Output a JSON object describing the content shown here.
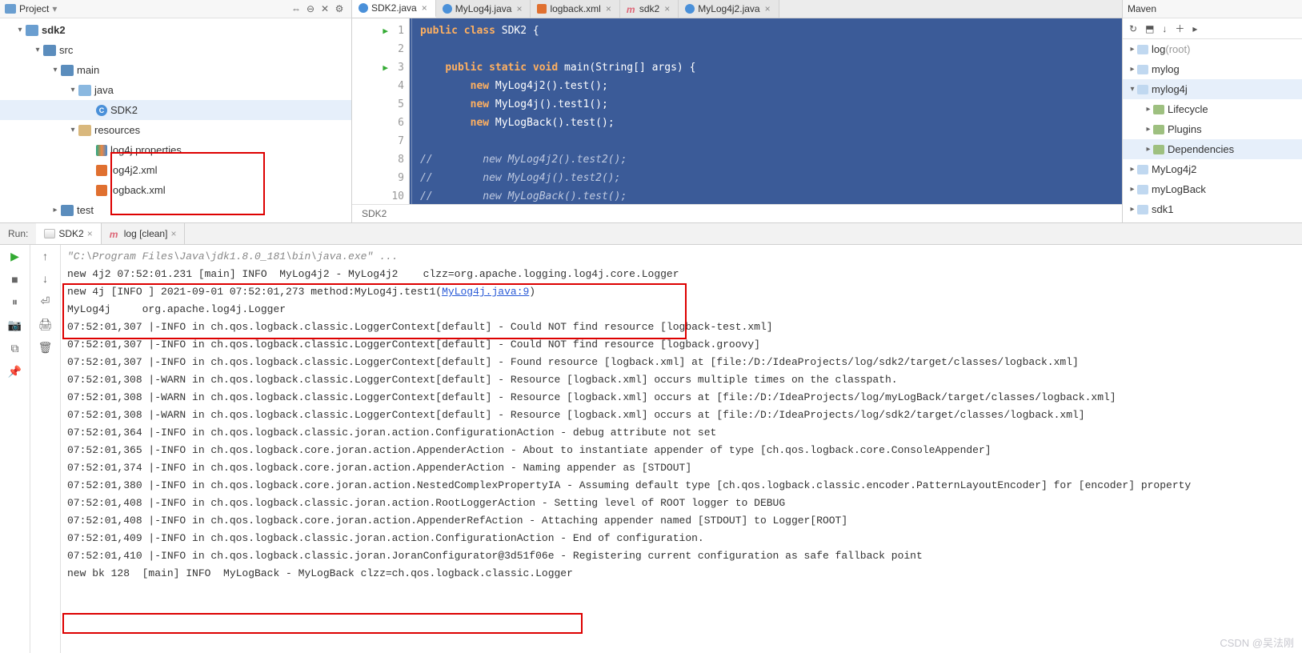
{
  "project": {
    "header_title": "Project",
    "toolbar_icons": [
      "⇔",
      "⊖",
      "✕",
      "⚙"
    ],
    "tree": [
      {
        "depth": 0,
        "twisty": "▾",
        "icon": "folder",
        "label": "sdk2",
        "bold": true
      },
      {
        "depth": 1,
        "twisty": "▾",
        "icon": "folder src",
        "label": "src"
      },
      {
        "depth": 2,
        "twisty": "▾",
        "icon": "folder src",
        "label": "main"
      },
      {
        "depth": 3,
        "twisty": "▾",
        "icon": "folder java",
        "label": "java"
      },
      {
        "depth": 4,
        "twisty": "",
        "icon": "cls",
        "icon_text": "C",
        "label": "SDK2",
        "selected": true
      },
      {
        "depth": 3,
        "twisty": "▾",
        "icon": "folder res",
        "label": "resources"
      },
      {
        "depth": 4,
        "twisty": "",
        "icon": "prop",
        "label": "log4j.properties"
      },
      {
        "depth": 4,
        "twisty": "",
        "icon": "xml",
        "label": "log4j2.xml"
      },
      {
        "depth": 4,
        "twisty": "",
        "icon": "xml",
        "label": "logback.xml"
      },
      {
        "depth": 2,
        "twisty": "▸",
        "icon": "folder src",
        "label": "test"
      }
    ]
  },
  "tabs": [
    {
      "icon": "c",
      "label": "SDK2.java",
      "active": true
    },
    {
      "icon": "c",
      "label": "MyLog4j.java"
    },
    {
      "icon": "x",
      "label": "logback.xml"
    },
    {
      "icon": "m",
      "label": "sdk2"
    },
    {
      "icon": "c",
      "label": "MyLog4j2.java"
    }
  ],
  "editor": {
    "lines": [
      {
        "n": 1,
        "run": true,
        "html": "<span class='kw'>public class</span> SDK2 {"
      },
      {
        "n": 2,
        "html": ""
      },
      {
        "n": 3,
        "run": true,
        "html": "    <span class='kw'>public static void</span> main(String[] args) {"
      },
      {
        "n": 4,
        "html": "        <span class='kw'>new</span> MyLog4j2().test();"
      },
      {
        "n": 5,
        "html": "        <span class='kw'>new</span> MyLog4j().test1();"
      },
      {
        "n": 6,
        "html": "        <span class='kw'>new</span> MyLogBack().test();"
      },
      {
        "n": 7,
        "html": ""
      },
      {
        "n": 8,
        "html": "<span class='cm'>//        new MyLog4j2().test2();</span>"
      },
      {
        "n": 9,
        "html": "<span class='cm'>//        new MyLog4j().test2();</span>"
      },
      {
        "n": 10,
        "html": "<span class='cm'>//        new MyLogBack().test();</span>"
      }
    ],
    "breadcrumb": "SDK2"
  },
  "maven": {
    "title": "Maven",
    "toolbar": [
      "↻",
      "⬒",
      "↓",
      "＋",
      "▸"
    ],
    "tree": [
      {
        "depth": 0,
        "tw": "▸",
        "icon": "mod",
        "label": "log",
        "dim": " (root)"
      },
      {
        "depth": 0,
        "tw": "▸",
        "icon": "mod",
        "label": "mylog"
      },
      {
        "depth": 0,
        "tw": "▾",
        "icon": "mod",
        "label": "mylog4j",
        "sel": true
      },
      {
        "depth": 1,
        "tw": "▸",
        "icon": "pl",
        "label": "Lifecycle"
      },
      {
        "depth": 1,
        "tw": "▸",
        "icon": "pl",
        "label": "Plugins"
      },
      {
        "depth": 1,
        "tw": "▸",
        "icon": "pl",
        "label": "Dependencies",
        "sel": true
      },
      {
        "depth": 0,
        "tw": "▸",
        "icon": "mod",
        "label": "MyLog4j2"
      },
      {
        "depth": 0,
        "tw": "▸",
        "icon": "mod",
        "label": "myLogBack"
      },
      {
        "depth": 0,
        "tw": "▸",
        "icon": "mod",
        "label": "sdk1"
      }
    ]
  },
  "run": {
    "label": "Run:",
    "tabs": [
      {
        "icon": "java",
        "label": "SDK2",
        "active": true
      },
      {
        "icon": "mvn",
        "label": "log [clean]"
      }
    ],
    "gutter1": [
      {
        "glyph": "▶",
        "cls": "play",
        "name": "run-button"
      },
      {
        "glyph": "■",
        "name": "stop-button"
      },
      {
        "glyph": "⏸",
        "name": "pause-button"
      },
      {
        "glyph": "📷",
        "name": "dump-threads-button"
      },
      {
        "glyph": "⧉",
        "name": "layout-button"
      },
      {
        "glyph": "📌",
        "name": "pin-button"
      }
    ],
    "gutter2": [
      {
        "glyph": "↑",
        "name": "up-button"
      },
      {
        "glyph": "↓",
        "name": "down-button"
      },
      {
        "glyph": "⏎",
        "name": "softwrap-button"
      },
      {
        "glyph": "🖨",
        "name": "print-button"
      },
      {
        "glyph": "🗑",
        "name": "clear-button"
      }
    ],
    "console": [
      {
        "t": "\"C:\\Program Files\\Java\\jdk1.8.0_181\\bin\\java.exe\" ...",
        "cls": "dim"
      },
      {
        "t": "new 4j2 07:52:01.231 [main] INFO  MyLog4j2 - MyLog4j2    clzz=org.apache.logging.log4j.core.Logger"
      },
      {
        "t": "new 4j [INFO ] 2021-09-01 07:52:01,273 method:MyLog4j.test1(",
        "link": "MyLog4j.java:9",
        "tail": ")"
      },
      {
        "t": "MyLog4j     org.apache.log4j.Logger"
      },
      {
        "t": "07:52:01,307 |-INFO in ch.qos.logback.classic.LoggerContext[default] - Could NOT find resource [logback-test.xml]"
      },
      {
        "t": "07:52:01,307 |-INFO in ch.qos.logback.classic.LoggerContext[default] - Could NOT find resource [logback.groovy]"
      },
      {
        "t": "07:52:01,307 |-INFO in ch.qos.logback.classic.LoggerContext[default] - Found resource [logback.xml] at [file:/D:/IdeaProjects/log/sdk2/target/classes/logback.xml]"
      },
      {
        "t": "07:52:01,308 |-WARN in ch.qos.logback.classic.LoggerContext[default] - Resource [logback.xml] occurs multiple times on the classpath."
      },
      {
        "t": "07:52:01,308 |-WARN in ch.qos.logback.classic.LoggerContext[default] - Resource [logback.xml] occurs at [file:/D:/IdeaProjects/log/myLogBack/target/classes/logback.xml]"
      },
      {
        "t": "07:52:01,308 |-WARN in ch.qos.logback.classic.LoggerContext[default] - Resource [logback.xml] occurs at [file:/D:/IdeaProjects/log/sdk2/target/classes/logback.xml]"
      },
      {
        "t": "07:52:01,364 |-INFO in ch.qos.logback.classic.joran.action.ConfigurationAction - debug attribute not set"
      },
      {
        "t": "07:52:01,365 |-INFO in ch.qos.logback.core.joran.action.AppenderAction - About to instantiate appender of type [ch.qos.logback.core.ConsoleAppender]"
      },
      {
        "t": "07:52:01,374 |-INFO in ch.qos.logback.core.joran.action.AppenderAction - Naming appender as [STDOUT]"
      },
      {
        "t": "07:52:01,380 |-INFO in ch.qos.logback.core.joran.action.NestedComplexPropertyIA - Assuming default type [ch.qos.logback.classic.encoder.PatternLayoutEncoder] for [encoder] property"
      },
      {
        "t": "07:52:01,408 |-INFO in ch.qos.logback.classic.joran.action.RootLoggerAction - Setting level of ROOT logger to DEBUG"
      },
      {
        "t": "07:52:01,408 |-INFO in ch.qos.logback.core.joran.action.AppenderRefAction - Attaching appender named [STDOUT] to Logger[ROOT]"
      },
      {
        "t": "07:52:01,409 |-INFO in ch.qos.logback.classic.joran.action.ConfigurationAction - End of configuration."
      },
      {
        "t": "07:52:01,410 |-INFO in ch.qos.logback.classic.joran.JoranConfigurator@3d51f06e - Registering current configuration as safe fallback point"
      },
      {
        "t": ""
      },
      {
        "t": "new bk 128  [main] INFO  MyLogBack - MyLogBack clzz=ch.qos.logback.classic.Logger"
      }
    ]
  },
  "watermark": "CSDN @吴法刚"
}
